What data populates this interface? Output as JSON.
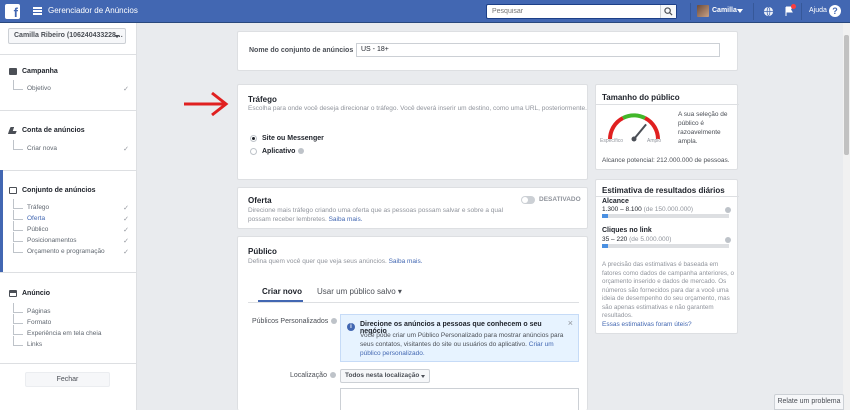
{
  "topbar": {
    "logo": "f",
    "app_title": "Gerenciador de Anúncios",
    "search_placeholder": "Pesquisar",
    "user_name": "Camilla",
    "help_label": "Ajuda",
    "help_glyph": "?"
  },
  "sidebar": {
    "account": "Camilla Ribeiro (106240433228…",
    "sections": [
      {
        "title": "Campanha",
        "items": [
          {
            "label": "Objetivo",
            "check": "✓"
          }
        ]
      },
      {
        "title": "Conta de anúncios",
        "items": [
          {
            "label": "Criar nova",
            "check": "✓"
          }
        ]
      },
      {
        "title": "Conjunto de anúncios",
        "items": [
          {
            "label": "Tráfego",
            "check": "✓"
          },
          {
            "label": "Oferta",
            "check": "✓"
          },
          {
            "label": "Público",
            "check": "✓"
          },
          {
            "label": "Posicionamentos",
            "check": "✓"
          },
          {
            "label": "Orçamento e programação",
            "check": "✓"
          }
        ]
      },
      {
        "title": "Anúncio",
        "items": [
          {
            "label": "Páginas"
          },
          {
            "label": "Formato"
          },
          {
            "label": "Experiência em tela cheia"
          },
          {
            "label": "Links"
          }
        ]
      }
    ],
    "close_label": "Fechar"
  },
  "adset_name": {
    "label": "Nome do conjunto de anúncios",
    "value": "US - 18+"
  },
  "traffic": {
    "title": "Tráfego",
    "description": "Escolha para onde você deseja direcionar o tráfego. Você deverá inserir um destino, como uma URL, posteriormente.",
    "options": [
      "Site ou Messenger",
      "Aplicativo"
    ],
    "selected": "Site ou Messenger"
  },
  "offer": {
    "title": "Oferta",
    "description": "Direcione mais tráfego criando uma oferta que as pessoas possam salvar e sobre a qual possam receber lembretes.",
    "link": "Saiba mais.",
    "toggle_label": "DESATIVADO"
  },
  "audience": {
    "title": "Público",
    "description": "Defina quem você quer que veja seus anúncios.",
    "link": "Saiba mais.",
    "tabs": [
      "Criar novo",
      "Usar um público salvo ▾"
    ],
    "custom_label": "Públicos Personalizados",
    "info_title": "Direcione os anúncios a pessoas que conhecem o seu negócio",
    "info_text": "Você pode criar um Público Personalizado para mostrar anúncios para seus contatos, visitantes do site ou usuários do aplicativo.",
    "info_link": "Criar um público personalizado.",
    "close_glyph": "×",
    "info_glyph": "i",
    "location_label": "Localização",
    "location_value": "Todos nesta localização"
  },
  "audience_size": {
    "title": "Tamanho do público",
    "gauge_label_left": "Específico",
    "gauge_label_right": "Amplo",
    "summary": "A sua seleção de público é razoavelmente ampla.",
    "potential": "Alcance potencial: 212.000.000 de pessoas.",
    "gauge_level": 0.72
  },
  "estimates": {
    "title": "Estimativa de resultados diários",
    "reach_label": "Alcance",
    "reach_value": "1.300 – 8.100",
    "reach_total": "(de 150.000.000)",
    "clicks_label": "Cliques no link",
    "clicks_value": "35 – 220",
    "clicks_total": "(de 5.000.000)",
    "reach_fill": 0.05,
    "clicks_fill": 0.05,
    "note": "A precisão das estimativas é baseada em fatores como dados de campanha anteriores, o orçamento inserido e dados de mercado. Os números são fornecidos para dar a você uma ideia de desempenho do seu orçamento, mas são apenas estimativas e não garantem resultados.",
    "link": "Essas estimativas foram úteis?"
  },
  "report_button": "Relate um problema",
  "colors": {
    "brand": "#4267b2",
    "arrow": "#e02020"
  }
}
